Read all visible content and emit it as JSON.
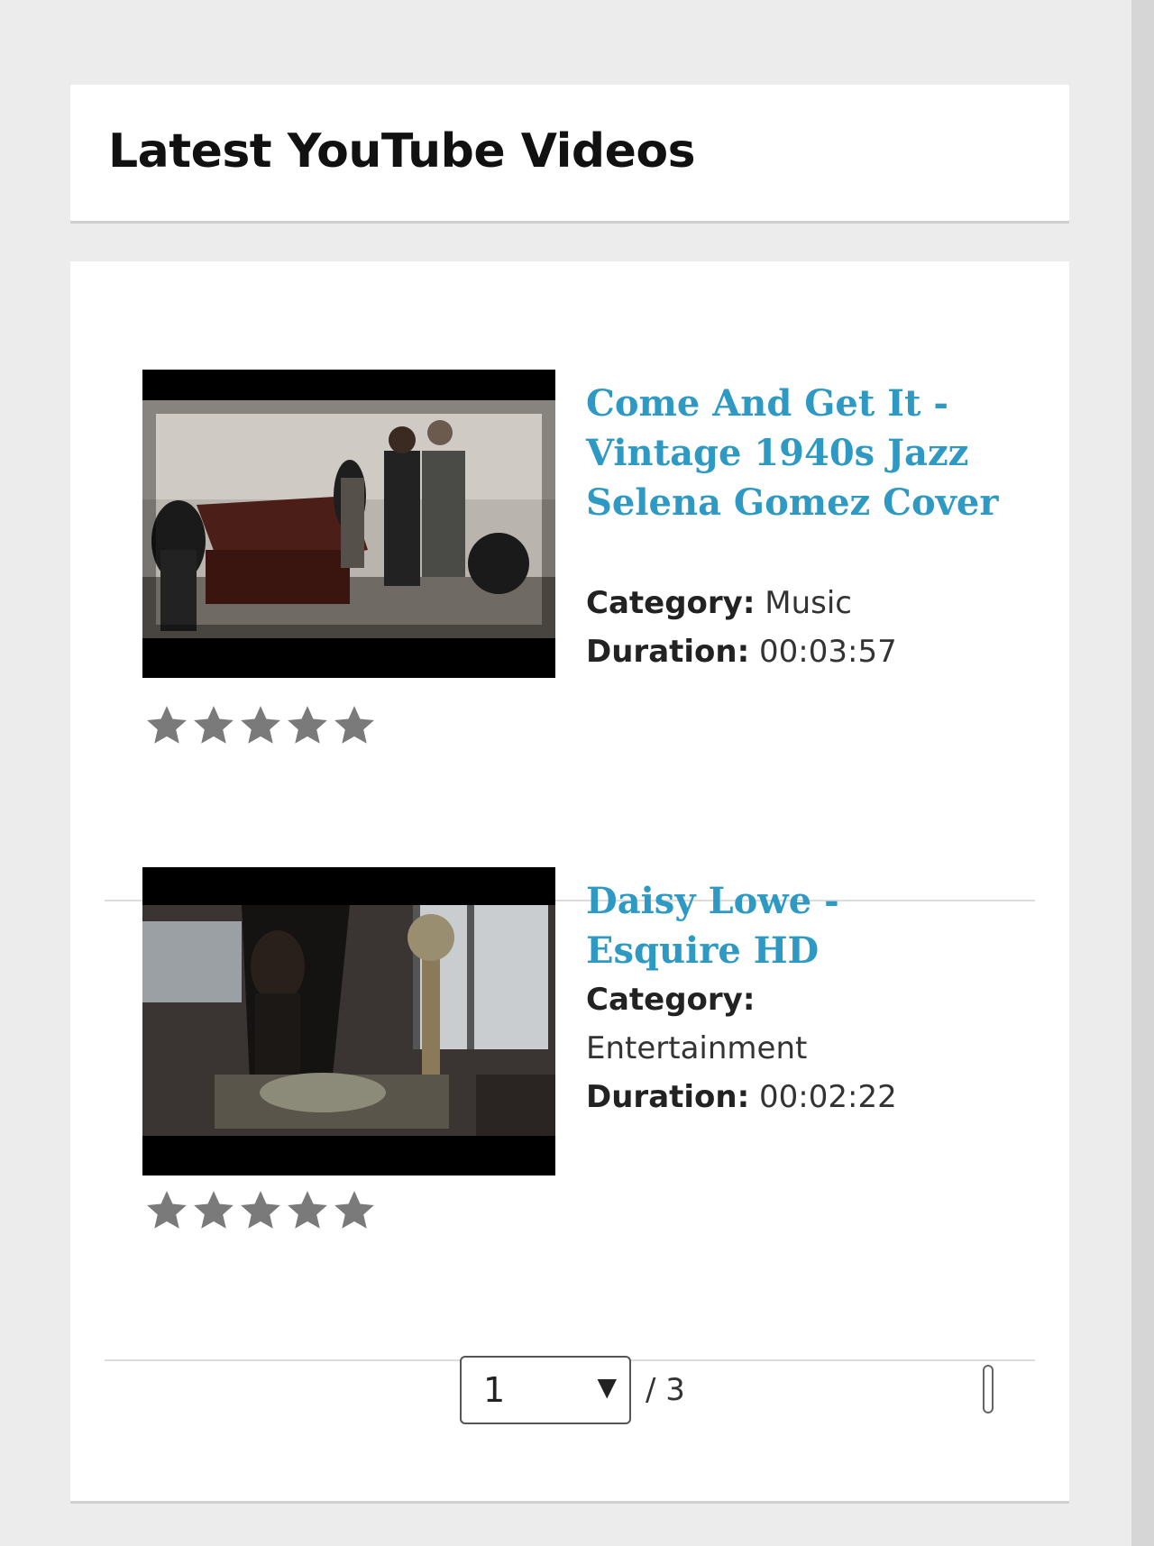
{
  "widget": {
    "title": "Latest YouTube Videos"
  },
  "videos": [
    {
      "title": "Come And Get It - Vintage 1940s Jazz Selena Gomez Cover",
      "category_label": "Category:",
      "category": "Music",
      "duration_label": "Duration:",
      "duration": "00:03:57",
      "rating": 5,
      "rating_max": 5
    },
    {
      "title": "Daisy Lowe - Esquire HD",
      "category_label": "Category:",
      "category": "Entertainment",
      "duration_label": "Duration:",
      "duration": "00:02:22",
      "rating": 5,
      "rating_max": 5
    }
  ],
  "pagination": {
    "current": "1",
    "total_label": "/ 3"
  },
  "colors": {
    "link": "#2e9ac4",
    "star": "#7a7a7a",
    "background": "#ececec"
  },
  "icons": {
    "star": "star-icon",
    "dropdown": "chevron-down-icon"
  }
}
